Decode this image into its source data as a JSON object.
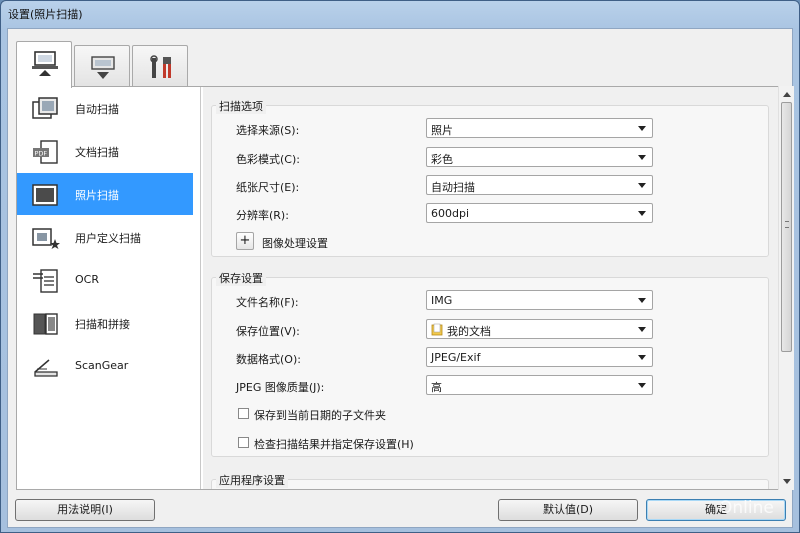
{
  "window": {
    "title": "设置(照片扫描)"
  },
  "tabs": [
    {
      "name": "scan-from-computer-tab",
      "icon": "computer-scan-icon",
      "active": true
    },
    {
      "name": "scan-from-panel-tab",
      "icon": "scanner-panel-icon",
      "active": false
    },
    {
      "name": "general-settings-tab",
      "icon": "tools-icon",
      "active": false
    }
  ],
  "sidebar": {
    "items": [
      {
        "label": "自动扫描",
        "icon": "auto-scan-icon",
        "selected": false
      },
      {
        "label": "文档扫描",
        "icon": "pdf-document-icon",
        "selected": false
      },
      {
        "label": "照片扫描",
        "icon": "photo-icon",
        "selected": true
      },
      {
        "label": "用户定义扫描",
        "icon": "custom-scan-icon",
        "selected": false
      },
      {
        "label": "OCR",
        "icon": "ocr-text-icon",
        "selected": false
      },
      {
        "label": "扫描和拼接",
        "icon": "stitch-icon",
        "selected": false
      },
      {
        "label": "ScanGear",
        "icon": "scangear-icon",
        "selected": false
      }
    ]
  },
  "scan_options": {
    "title": "扫描选项",
    "rows": [
      {
        "label": "选择来源(S):",
        "value": "照片"
      },
      {
        "label": "色彩模式(C):",
        "value": "彩色"
      },
      {
        "label": "纸张尺寸(E):",
        "value": "自动扫描"
      },
      {
        "label": "分辨率(R):",
        "value": "600dpi"
      }
    ],
    "image_processing": {
      "button": "+",
      "label": "图像处理设置"
    }
  },
  "save_settings": {
    "title": "保存设置",
    "rows": [
      {
        "label": "文件名称(F):",
        "value": "IMG"
      },
      {
        "label": "保存位置(V):",
        "value": "我的文档"
      },
      {
        "label": "数据格式(O):",
        "value": "JPEG/Exif"
      },
      {
        "label": "JPEG 图像质量(J):",
        "value": "高"
      }
    ],
    "checkboxes": [
      {
        "label": "保存到当前日期的子文件夹",
        "checked": false
      },
      {
        "label": "检查扫描结果并指定保存设置(H)",
        "checked": false
      }
    ]
  },
  "app_settings": {
    "title": "应用程序设置"
  },
  "footer": {
    "help_label": "用法说明(I)",
    "defaults_label": "默认值(D)",
    "ok_label": "确定"
  },
  "watermark": "Online",
  "colors": {
    "selection": "#3399ff",
    "titlebar": "#b9d1ea",
    "dialog_bg": "#f0f0f0"
  }
}
